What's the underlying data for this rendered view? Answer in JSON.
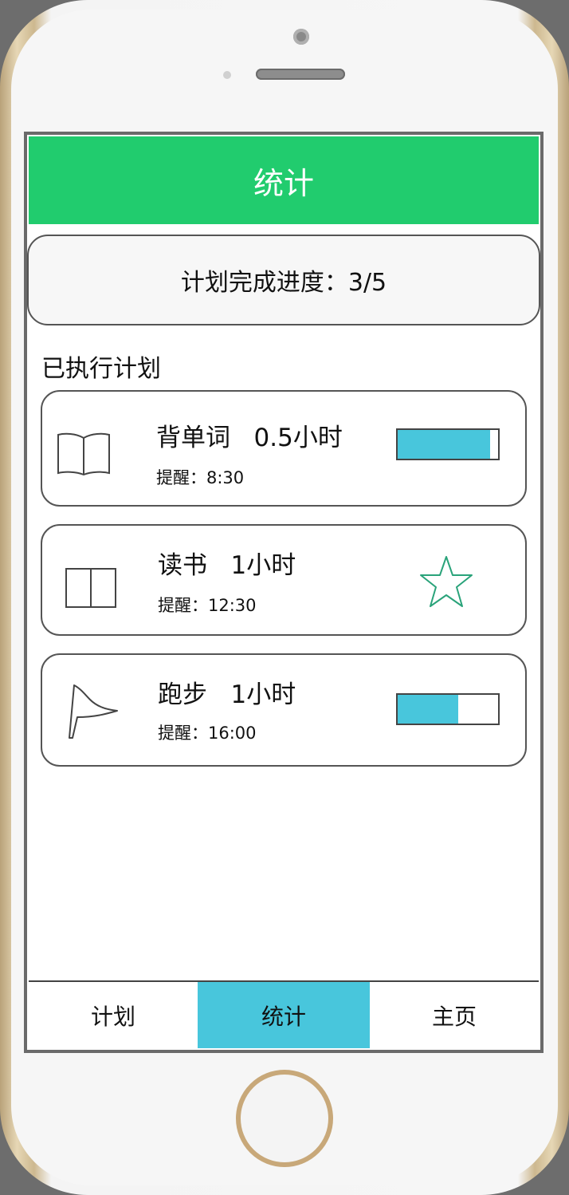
{
  "header": {
    "title": "统计"
  },
  "progress": {
    "label": "计划完成进度：3/5"
  },
  "section": {
    "title": "已执行计划"
  },
  "plans": [
    {
      "title": "背单词   0.5小时",
      "reminder": "提醒：8:30",
      "icon": "book-icon",
      "status": "progress-bar",
      "progress": 0.92
    },
    {
      "title": "读书   1小时",
      "reminder": "提醒：12:30",
      "icon": "book-icon",
      "status": "star-icon"
    },
    {
      "title": "跑步   1小时",
      "reminder": "提醒：16:00",
      "icon": "flag-icon",
      "status": "progress-bar",
      "progress": 0.6
    }
  ],
  "tabs": [
    {
      "label": "计划",
      "active": false
    },
    {
      "label": "统计",
      "active": true
    },
    {
      "label": "主页",
      "active": false
    }
  ],
  "colors": {
    "header": "#21cc6e",
    "accent": "#48c6dc",
    "star": "#2aa37a"
  }
}
